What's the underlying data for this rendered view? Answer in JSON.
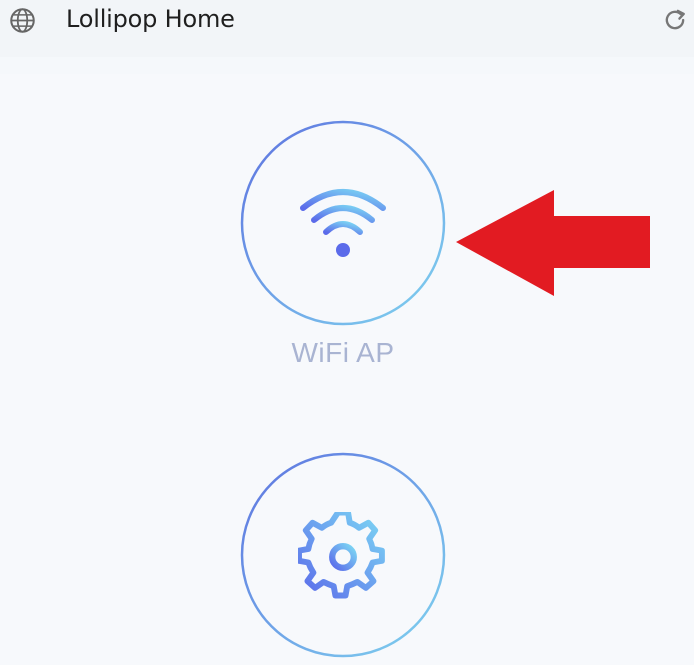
{
  "header": {
    "title": "Lollipop Home",
    "left_icon": "globe-icon",
    "right_icon": "refresh-icon"
  },
  "main": {
    "buttons": [
      {
        "id": "wifi",
        "label": "WiFi AP",
        "icon": "wifi-icon"
      },
      {
        "id": "settings",
        "label": "",
        "icon": "gear-icon"
      }
    ],
    "annotation": {
      "icon": "red-arrow-icon",
      "color": "#e21b22"
    }
  },
  "colors": {
    "ring_start": "#5e73e0",
    "ring_end": "#7fd3ef",
    "icon_start": "#5b6bea",
    "icon_end": "#7cd7f4",
    "label": "#a9b4d2"
  }
}
